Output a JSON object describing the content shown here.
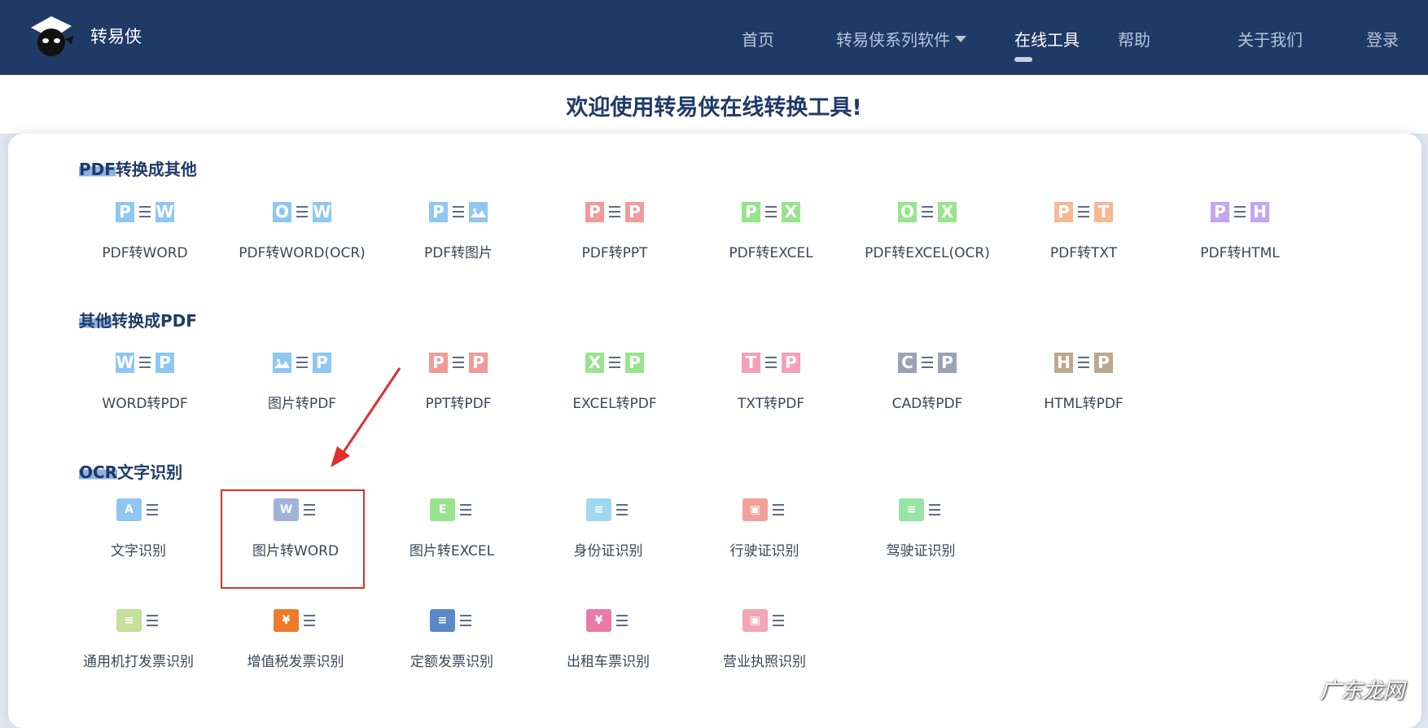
{
  "header": {
    "brand": "转易侠",
    "nav": [
      {
        "label": "首页",
        "active": false
      },
      {
        "label": "转易侠系列软件",
        "active": false,
        "has_dropdown": true
      },
      {
        "label": "在线工具",
        "active": true
      },
      {
        "label": "帮助",
        "active": false
      },
      {
        "label": "关于我们",
        "active": false
      },
      {
        "label": "登录",
        "active": false
      }
    ]
  },
  "welcome": {
    "title": "欢迎使用转易侠在线转换工具!"
  },
  "sections": [
    {
      "title_highlight": "PDF",
      "title_rest": "转换成其他",
      "tools": [
        {
          "label": "PDF转WORD",
          "left": "P",
          "right": "W",
          "left_color": "#8fc7f3",
          "right_color": "#8fc7f3"
        },
        {
          "label": "PDF转WORD(OCR)",
          "left": "O",
          "right": "W",
          "left_color": "#8fc7f3",
          "right_color": "#8fc7f3"
        },
        {
          "label": "PDF转图片",
          "left": "P",
          "right": "image",
          "left_color": "#8fc7f3",
          "right_color": "#8fc7f3"
        },
        {
          "label": "PDF转PPT",
          "left": "P",
          "right": "P",
          "left_color": "#f29a9a",
          "right_color": "#f29a9a"
        },
        {
          "label": "PDF转EXCEL",
          "left": "P",
          "right": "X",
          "left_color": "#98e38e",
          "right_color": "#98e38e"
        },
        {
          "label": "PDF转EXCEL(OCR)",
          "left": "O",
          "right": "X",
          "left_color": "#98e38e",
          "right_color": "#98e38e"
        },
        {
          "label": "PDF转TXT",
          "left": "P",
          "right": "T",
          "left_color": "#f7b896",
          "right_color": "#f7b896"
        },
        {
          "label": "PDF转HTML",
          "left": "P",
          "right": "H",
          "left_color": "#c3a6ef",
          "right_color": "#c3a6ef"
        }
      ]
    },
    {
      "title_highlight": "其他",
      "title_rest": "转换成PDF",
      "tools": [
        {
          "label": "WORD转PDF",
          "left": "W",
          "right": "P",
          "left_color": "#8fc7f3",
          "right_color": "#8fc7f3"
        },
        {
          "label": "图片转PDF",
          "left": "image",
          "right": "P",
          "left_color": "#8fc7f3",
          "right_color": "#8fc7f3"
        },
        {
          "label": "PPT转PDF",
          "left": "P",
          "right": "P",
          "left_color": "#f29a9a",
          "right_color": "#f29a9a"
        },
        {
          "label": "EXCEL转PDF",
          "left": "X",
          "right": "P",
          "left_color": "#98e38e",
          "right_color": "#98e38e"
        },
        {
          "label": "TXT转PDF",
          "left": "T",
          "right": "P",
          "left_color": "#f5a0b8",
          "right_color": "#f5a0b8"
        },
        {
          "label": "CAD转PDF",
          "left": "C",
          "right": "P",
          "left_color": "#9aa3b4",
          "right_color": "#9aa3b4"
        },
        {
          "label": "HTML转PDF",
          "left": "H",
          "right": "P",
          "left_color": "#bca88f",
          "right_color": "#bca88f"
        }
      ]
    },
    {
      "title_highlight": "OCR",
      "title_rest": "文字识别",
      "tools": [
        {
          "label": "文字识别",
          "glyph": "A",
          "color": "#8fc7f3"
        },
        {
          "label": "图片转WORD",
          "glyph": "W",
          "color": "#9fb3d6"
        },
        {
          "label": "图片转EXCEL",
          "glyph": "E",
          "color": "#98e38e"
        },
        {
          "label": "身份证识别",
          "glyph": "≡",
          "color": "#9ed8f0"
        },
        {
          "label": "行驶证识别",
          "glyph": "▣",
          "color": "#f2a09a"
        },
        {
          "label": "驾驶证识别",
          "glyph": "≡",
          "color": "#98e3a6"
        },
        {
          "label": "通用机打发票识别",
          "glyph": "≡",
          "color": "#c4e09a"
        },
        {
          "label": "增值税发票识别",
          "glyph": "¥",
          "color": "#ef7a2a"
        },
        {
          "label": "定额发票识别",
          "glyph": "≡",
          "color": "#5b88c7"
        },
        {
          "label": "出租车票识别",
          "glyph": "¥",
          "color": "#e87aa6"
        },
        {
          "label": "营业执照识别",
          "glyph": "▣",
          "color": "#f2a6b8"
        }
      ]
    }
  ],
  "watermark": "广东龙网"
}
